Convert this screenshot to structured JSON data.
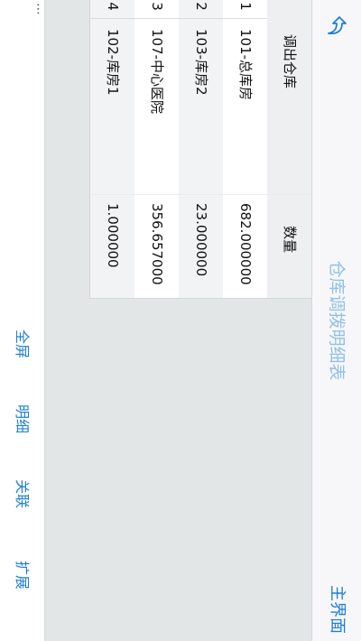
{
  "nav": {
    "title": "仓库调拨明细表",
    "home_label": "主界面"
  },
  "grid": {
    "headers": {
      "index": "",
      "warehouse": "调出仓库",
      "quantity": "数量"
    },
    "rows": [
      {
        "index": "1",
        "warehouse": "101-总库房",
        "quantity": "682.000000"
      },
      {
        "index": "2",
        "warehouse": "103-库房2",
        "quantity": "23.000000"
      },
      {
        "index": "3",
        "warehouse": "107-中心医院",
        "quantity": "356.657000"
      },
      {
        "index": "4",
        "warehouse": "102-库房1",
        "quantity": "1.000000"
      }
    ]
  },
  "toolbar": {
    "fullscreen_label": "全屏",
    "detail_label": "明细",
    "link_label": "关联",
    "expand_label": "扩展"
  },
  "colors": {
    "accent": "#1f7fd4",
    "title": "#8fc0ea",
    "content_bg": "#e3e6e7"
  }
}
